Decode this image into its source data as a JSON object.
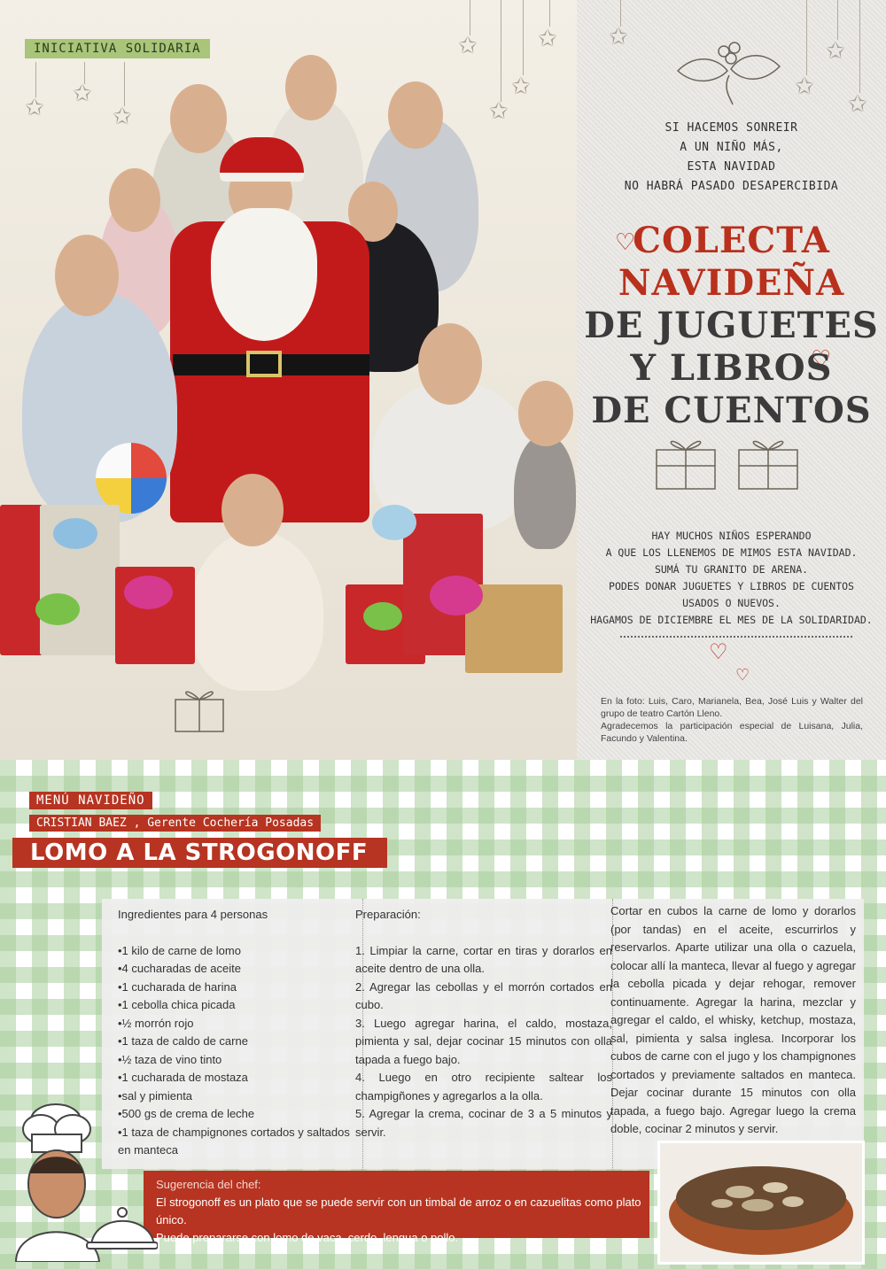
{
  "top": {
    "tag": "INICIATIVA SOLIDARIA",
    "slogan_lines": [
      "SI HACEMOS SONREIR",
      "A UN NIÑO MÁS,",
      "ESTA NAVIDAD",
      "NO HABRÁ PASADO DESAPERCIBIDA"
    ],
    "colecta_lines": [
      "COLECTA",
      "NAVIDEÑA",
      "DE JUGUETES",
      "Y LIBROS",
      "DE CUENTOS"
    ],
    "info_lines": [
      "HAY MUCHOS NIÑOS ESPERANDO",
      "A QUE LOS LLENEMOS DE MIMOS ESTA NAVIDAD.",
      "SUMÁ TU GRANITO DE ARENA.",
      "PODES DONAR JUGUETES Y LIBROS DE CUENTOS",
      "USADOS O NUEVOS.",
      "HAGAMOS DE DICIEMBRE EL MES DE LA SOLIDARIDAD."
    ],
    "caption_1": "En la foto: Luis, Caro, Marianela, Bea, José Luis y Walter del grupo de teatro Cartón Lleno.",
    "caption_2": "Agradecemos la participación especial de Luisana, Julia, Facundo y Valentina."
  },
  "menu": {
    "label": "MENÚ NAVIDEÑO",
    "chef": "CRISTIAN BAEZ , Gerente Cochería Posadas",
    "title": "LOMO A LA STROGONOFF"
  },
  "recipe": {
    "ingredients_title": "Ingredientes para 4 personas",
    "ingredients": [
      "•1 kilo de carne de lomo",
      "•4 cucharadas de aceite",
      "•1 cucharada de harina",
      "•1 cebolla chica picada",
      "•½ morrón rojo",
      "•1 taza de caldo de carne",
      "•½ taza de vino tinto",
      "•1 cucharada de mostaza",
      "•sal y pimienta",
      "•500 gs de crema de leche",
      "•1 taza de champignones cortados y saltados en manteca"
    ],
    "prep_title": "Preparación:",
    "steps": [
      "1. Limpiar la carne, cortar en tiras y dorarlos en aceite dentro de una olla.",
      "2. Agregar las cebollas y el morrón cortados en cubo.",
      "3. Luego agregar harina, el caldo, mostaza, pimienta y sal, dejar cocinar 15 minutos con olla tapada a fuego bajo.",
      "4. Luego en otro recipiente saltear los champigñones y agregarlos a la olla.",
      "5. Agregar la crema, cocinar de 3 a 5 minutos y servir."
    ],
    "method": "Cortar en cubos la carne de lomo y dorarlos (por tandas) en el aceite, escurrirlos y reservarlos. Aparte utilizar una olla o cazuela, colocar allí la manteca, llevar al fuego y agregar la cebolla picada y dejar rehogar, remover continuamente. Agregar la harina, mezclar y agregar el caldo, el whisky, ketchup, mostaza, sal, pimienta y salsa inglesa. Incorporar los cubos de carne con el jugo y los champignones cortados y previamente saltados en manteca. Dejar cocinar durante 15 minutos con olla tapada, a fuego bajo. Agregar luego la crema doble, cocinar 2 minutos y servir."
  },
  "sugerencia": {
    "title": "Sugerencia del chef:",
    "line1": "El strogonoff es un plato que se puede servir con un timbal de arroz o en cazuelitas como plato único.",
    "line2": "Puede prepararse con lomo de vaca, cerdo, lengua o pollo."
  },
  "colors": {
    "accent_red": "#b63421",
    "tag_green": "#a8c57a",
    "check_green": "#a8ce9c"
  }
}
